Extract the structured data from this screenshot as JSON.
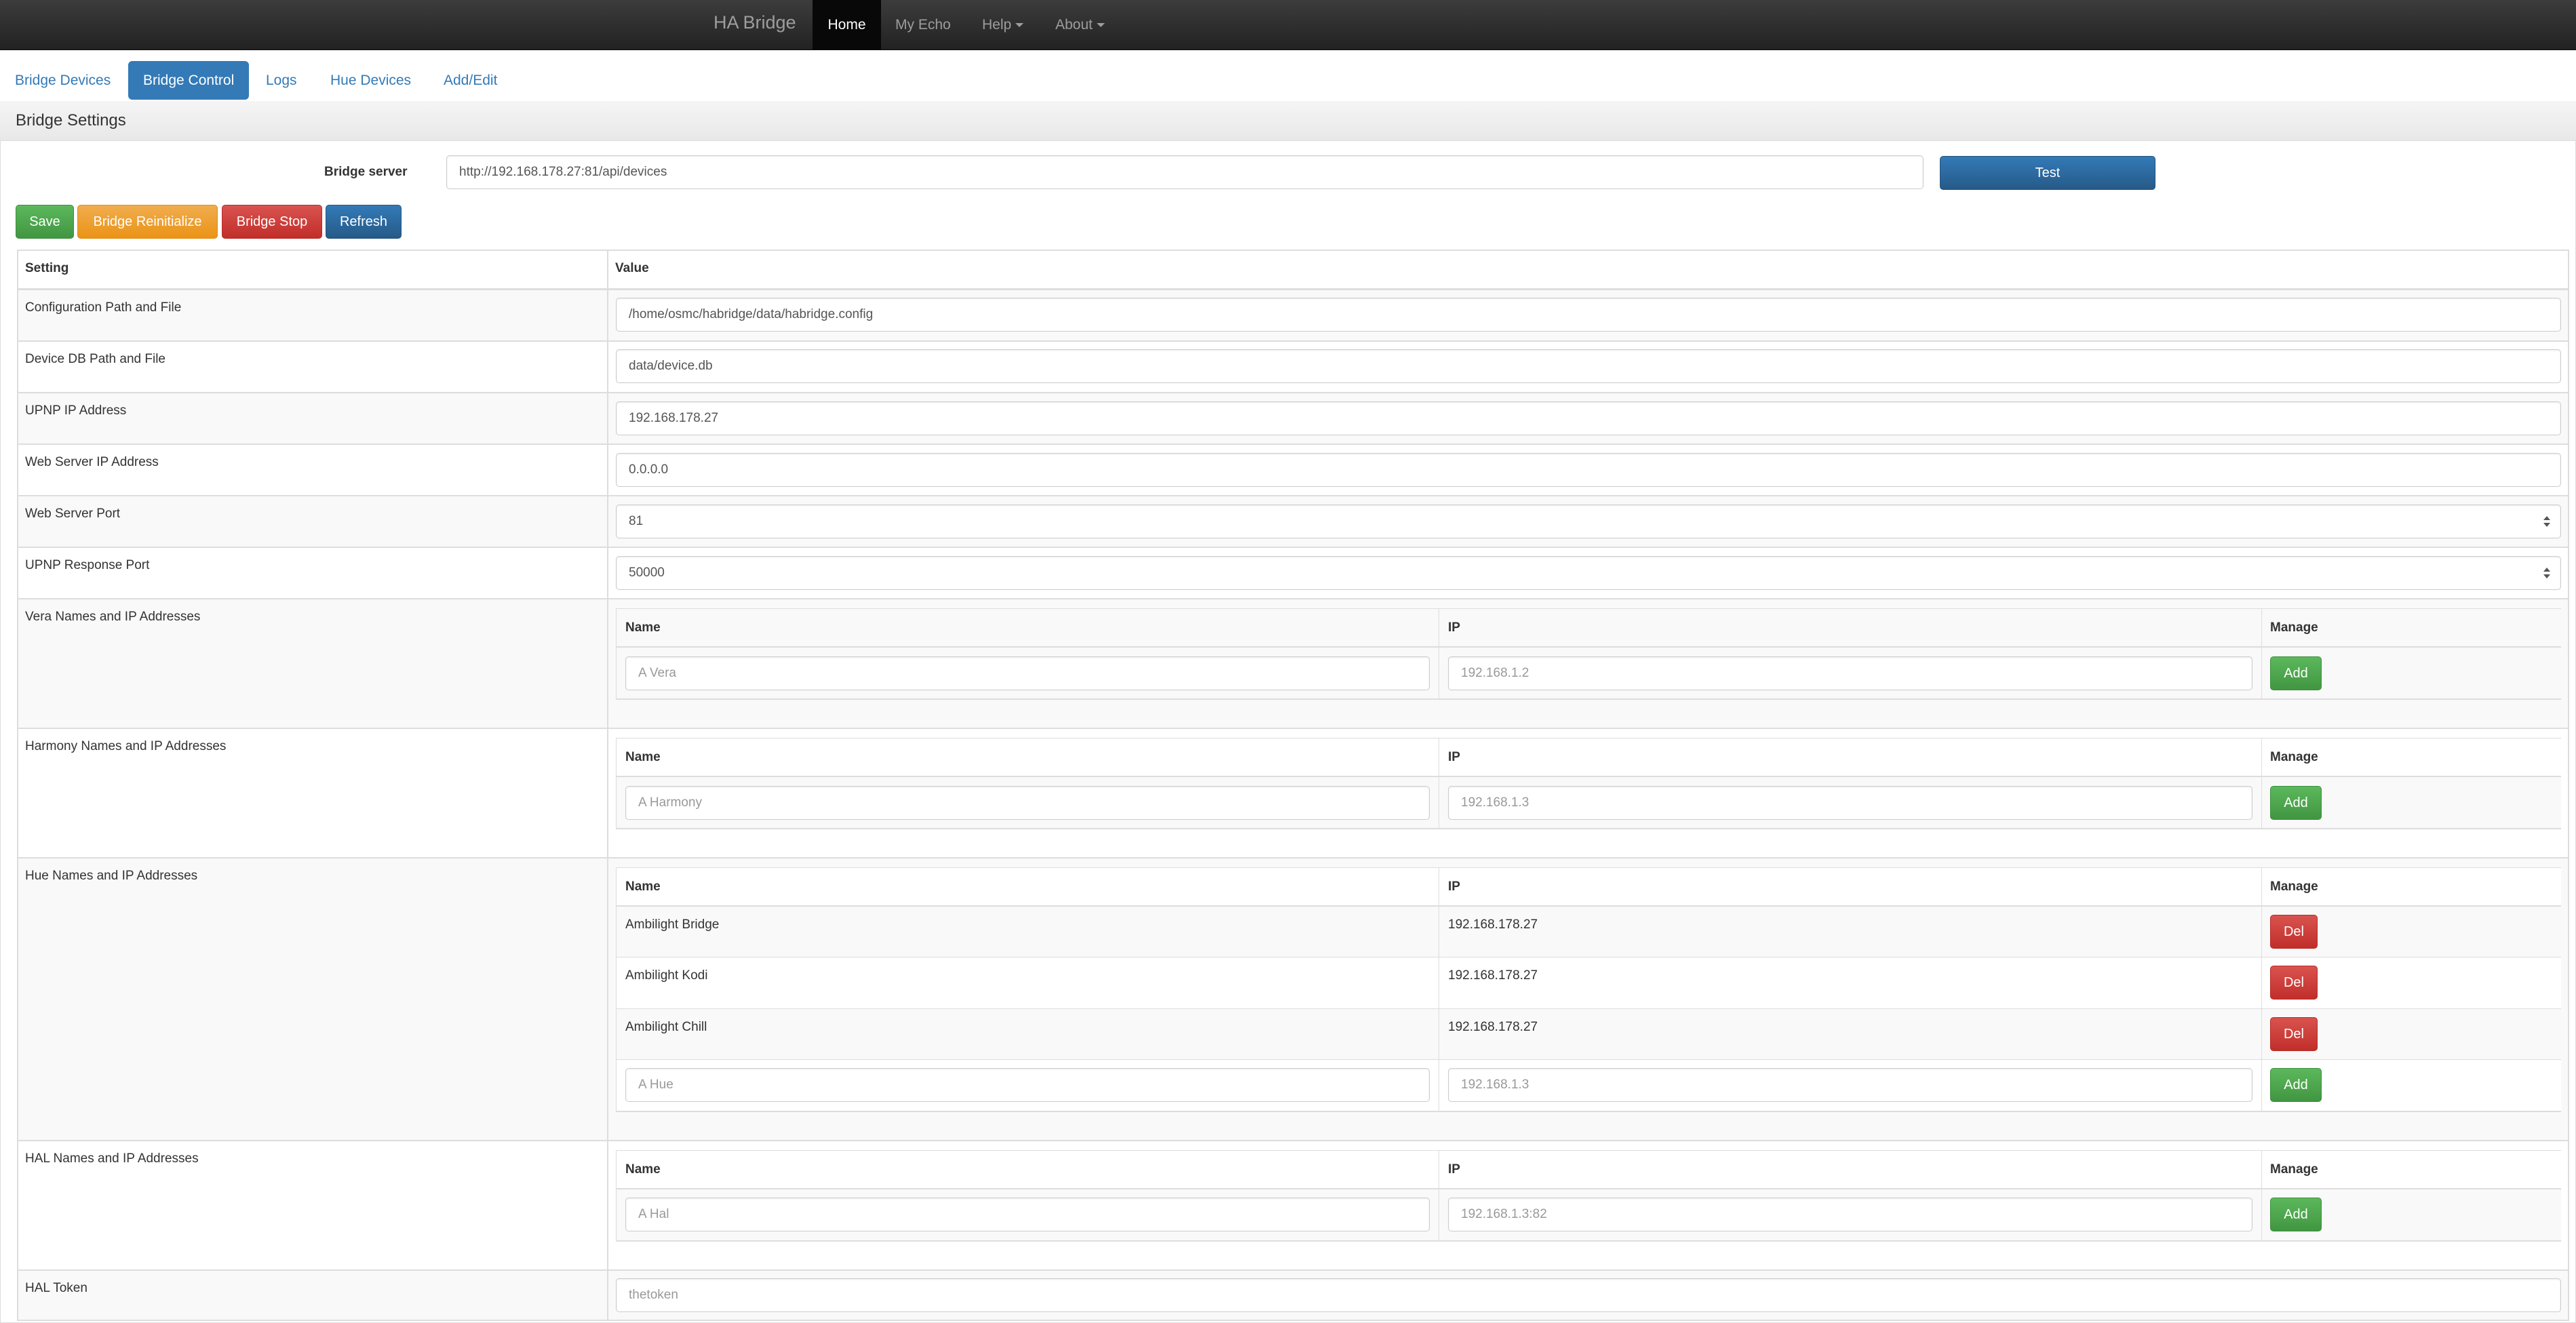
{
  "navbar": {
    "brand": "HA Bridge",
    "items": [
      {
        "label": "Home",
        "active": true
      },
      {
        "label": "My Echo",
        "active": false
      },
      {
        "label": "Help",
        "active": false,
        "dropdown": true
      },
      {
        "label": "About",
        "active": false,
        "dropdown": true
      }
    ]
  },
  "tabs": [
    {
      "label": "Bridge Devices",
      "active": false
    },
    {
      "label": "Bridge Control",
      "active": true
    },
    {
      "label": "Logs",
      "active": false
    },
    {
      "label": "Hue Devices",
      "active": false
    },
    {
      "label": "Add/Edit",
      "active": false
    }
  ],
  "panel": {
    "title": "Bridge Settings",
    "bridge_server_label": "Bridge server",
    "bridge_server_value": "http://192.168.178.27:81/api/devices",
    "test_button": "Test",
    "actions": {
      "save": "Save",
      "reinitialize": "Bridge Reinitialize",
      "stop": "Bridge Stop",
      "refresh": "Refresh"
    }
  },
  "settings": {
    "headers": {
      "setting": "Setting",
      "value": "Value"
    },
    "rows": [
      {
        "label": "Configuration Path and File",
        "value": "/home/osmc/habridge/data/habridge.config"
      },
      {
        "label": "Device DB Path and File",
        "value": "data/device.db"
      },
      {
        "label": "UPNP IP Address",
        "value": "192.168.178.27"
      },
      {
        "label": "Web Server IP Address",
        "value": "0.0.0.0"
      },
      {
        "label": "Web Server Port",
        "value": "81"
      },
      {
        "label": "UPNP Response Port",
        "value": "50000"
      }
    ],
    "sub_headers": {
      "name": "Name",
      "ip": "IP",
      "manage": "Manage"
    },
    "vera": {
      "label": "Vera Names and IP Addresses",
      "name_placeholder": "A Vera",
      "ip_placeholder": "192.168.1.2",
      "add": "Add"
    },
    "harmony": {
      "label": "Harmony Names and IP Addresses",
      "name_placeholder": "A Harmony",
      "ip_placeholder": "192.168.1.3",
      "add": "Add"
    },
    "hue": {
      "label": "Hue Names and IP Addresses",
      "entries": [
        {
          "name": "Ambilight Bridge",
          "ip": "192.168.178.27",
          "del": "Del"
        },
        {
          "name": "Ambilight Kodi",
          "ip": "192.168.178.27",
          "del": "Del"
        },
        {
          "name": "Ambilight Chill",
          "ip": "192.168.178.27",
          "del": "Del"
        }
      ],
      "name_placeholder": "A Hue",
      "ip_placeholder": "192.168.1.3",
      "add": "Add"
    },
    "hal": {
      "label": "HAL Names and IP Addresses",
      "name_placeholder": "A Hal",
      "ip_placeholder": "192.168.1.3:82",
      "add": "Add"
    },
    "hal_token": {
      "label": "HAL Token",
      "placeholder": "thetoken"
    }
  }
}
